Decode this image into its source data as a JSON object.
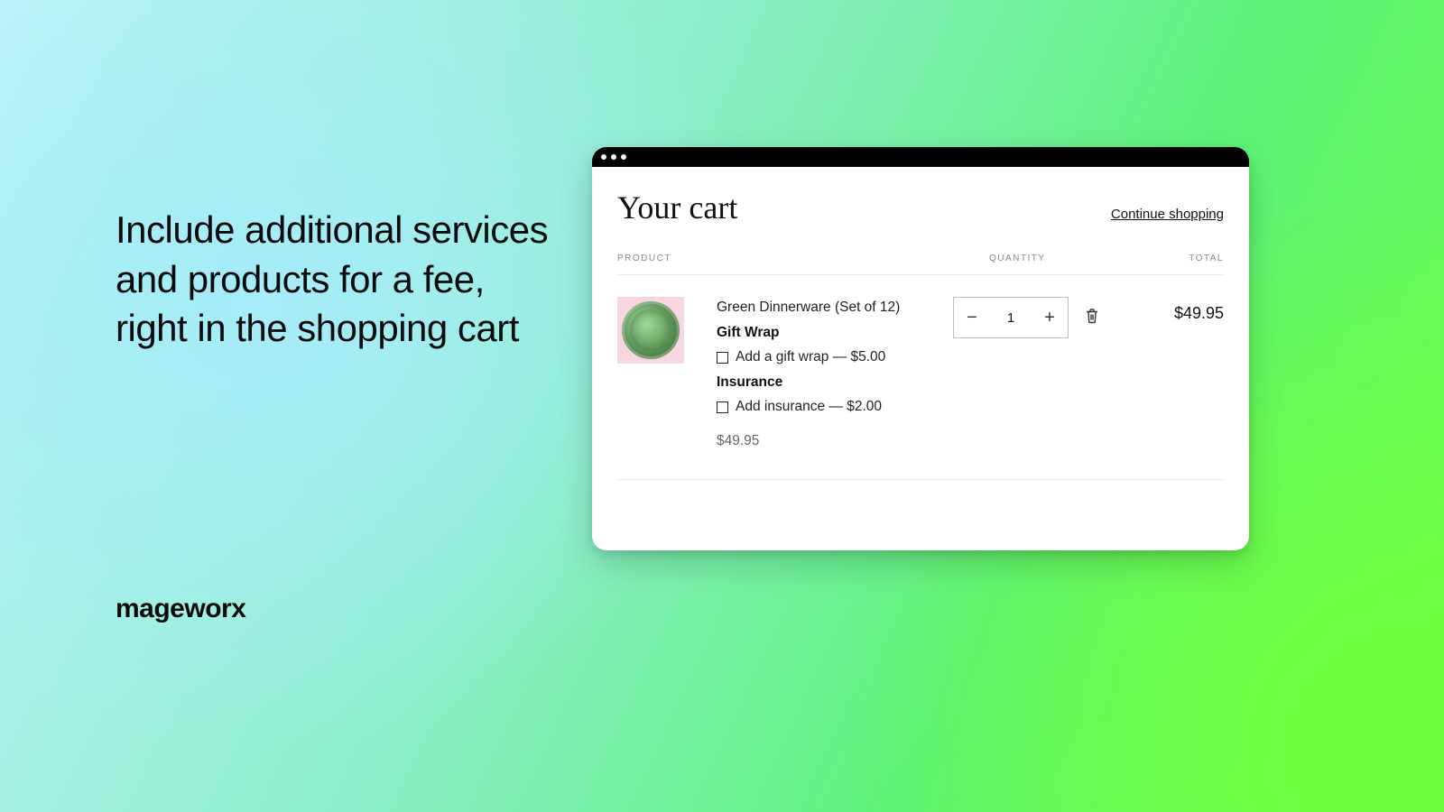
{
  "marketing": {
    "headline": "Include additional services and products for a fee, right in the shopping cart",
    "brand": "mageworx"
  },
  "cart": {
    "title": "Your cart",
    "continue_label": "Continue shopping",
    "columns": {
      "product": "PRODUCT",
      "quantity": "QUANTITY",
      "total": "TOTAL"
    },
    "item": {
      "name": "Green Dinnerware (Set of 12)",
      "options": [
        {
          "heading": "Gift Wrap",
          "label": "Add a gift wrap — $5.00"
        },
        {
          "heading": "Insurance",
          "label": "Add insurance — $2.00"
        }
      ],
      "unit_price": "$49.95",
      "quantity": "1",
      "line_total": "$49.95"
    }
  }
}
